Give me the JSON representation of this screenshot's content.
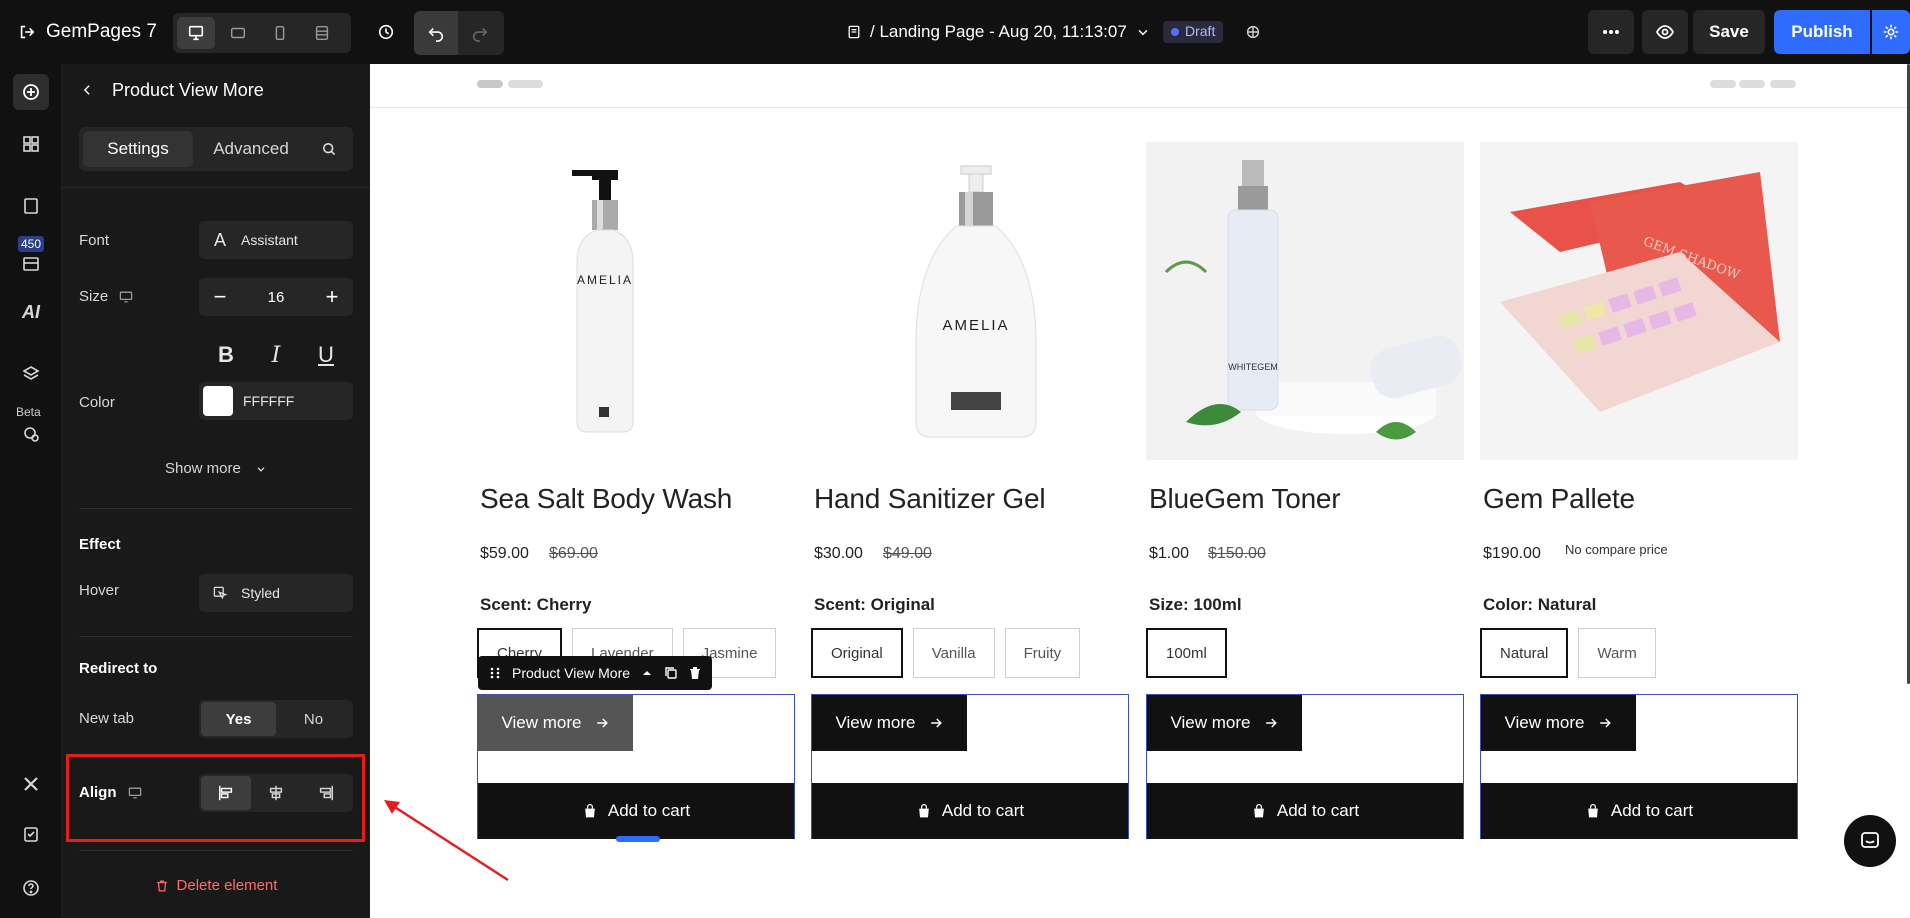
{
  "app": {
    "name": "GemPages 7",
    "page_title": "/ Landing Page - Aug 20, 11:13:07",
    "status": "Draft",
    "save_label": "Save",
    "publish_label": "Publish",
    "accent_color": "#2f6bff"
  },
  "rail": {
    "pages_count": "450",
    "beta_label": "Beta",
    "ai_label": "AI"
  },
  "panel": {
    "title": "Product View More",
    "tabs": [
      "Settings",
      "Advanced"
    ],
    "font_label": "Font",
    "font_value": "Assistant",
    "size_label": "Size",
    "size_value": "16",
    "color_label": "Color",
    "color_value": "FFFFFF",
    "show_more": "Show more",
    "effect_title": "Effect",
    "hover_label": "Hover",
    "hover_value": "Styled",
    "redirect_title": "Redirect to",
    "new_tab_label": "New tab",
    "new_tab_yes": "Yes",
    "new_tab_no": "No",
    "align_label": "Align",
    "delete_label": "Delete element"
  },
  "canvas": {
    "selected_element": "Product View More",
    "products": [
      {
        "name": "Sea Salt Body Wash",
        "price": "$59.00",
        "compare": "$69.00",
        "option_label": "Scent: Cherry",
        "options": [
          "Cherry",
          "Lavender",
          "Jasmine"
        ],
        "selected": 0,
        "view_more": "View more",
        "add_to_cart": "Add to cart"
      },
      {
        "name": "Hand Sanitizer Gel",
        "price": "$30.00",
        "compare": "$49.00",
        "option_label": "Scent: Original",
        "options": [
          "Original",
          "Vanilla",
          "Fruity"
        ],
        "selected": 0,
        "view_more": "View more",
        "add_to_cart": "Add to cart"
      },
      {
        "name": "BlueGem Toner",
        "price": "$1.00",
        "compare": "$150.00",
        "option_label": "Size: 100ml",
        "options": [
          "100ml"
        ],
        "selected": 0,
        "view_more": "View more",
        "add_to_cart": "Add to cart"
      },
      {
        "name": "Gem Pallete",
        "price": "$190.00",
        "compare": "No compare price",
        "option_label": "Color: Natural",
        "options": [
          "Natural",
          "Warm"
        ],
        "selected": 0,
        "view_more": "View more",
        "add_to_cart": "Add to cart"
      }
    ]
  }
}
